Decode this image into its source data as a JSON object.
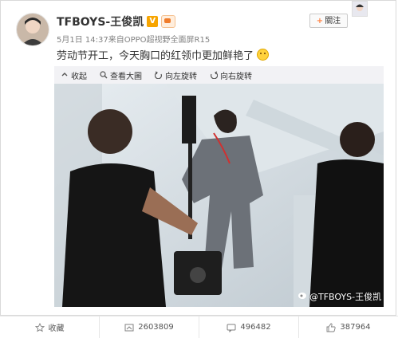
{
  "post": {
    "username": "TFBOYS-王俊凯",
    "verified_badge": "V",
    "meta": "5月1日 14:37来自OPPO超视野全面屏R15",
    "text": "劳动节开工，今天胸口的红领巾更加鲜艳了",
    "follow_label": "關注",
    "follow_plus": "+",
    "watermark": "@TFBOYS-王俊凯"
  },
  "toolbar": {
    "collapse": "收起",
    "view_large": "查看大圖",
    "rotate_left": "向左旋转",
    "rotate_right": "向右旋转"
  },
  "footer": {
    "favorite": "收藏",
    "repost_count": "2603809",
    "comment_count": "496482",
    "like_count": "387964"
  },
  "icons": [
    "collapse-icon",
    "zoom-icon",
    "rotate-left-icon",
    "rotate-right-icon",
    "star-icon",
    "repost-icon",
    "comment-icon",
    "like-icon"
  ],
  "colors": {
    "accent": "#ff8140",
    "badge": "#f7a500",
    "toolbar_bg": "#f2f2f5"
  }
}
